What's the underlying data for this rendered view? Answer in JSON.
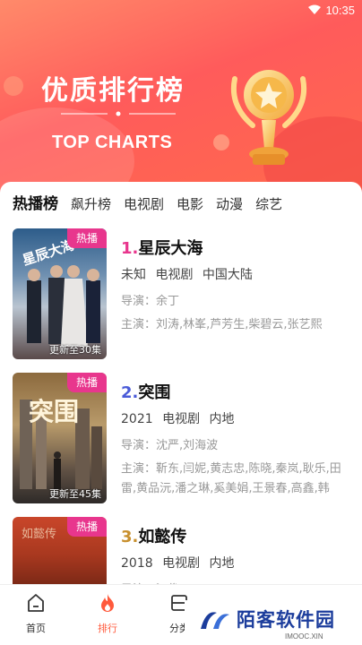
{
  "status_bar": {
    "time": "10:35"
  },
  "banner": {
    "title": "优质排行榜",
    "subtitle": "TOP CHARTS"
  },
  "tabs": [
    {
      "label": "热播榜",
      "active": true
    },
    {
      "label": "飙升榜"
    },
    {
      "label": "电视剧"
    },
    {
      "label": "电影"
    },
    {
      "label": "动漫"
    },
    {
      "label": "综艺"
    }
  ],
  "items": [
    {
      "rank": "1.",
      "rank_color": "#e8368d",
      "title": "星辰大海",
      "year": "未知",
      "type": "电视剧",
      "region": "中国大陆",
      "director": "导演：余丁",
      "cast": "主演：刘涛,林峯,芦芳生,柴碧云,张艺熙",
      "badge": "热播",
      "episode": "更新至30集",
      "poster_text": "星辰大海"
    },
    {
      "rank": "2.",
      "rank_color": "#4a5bd8",
      "title": "突围",
      "year": "2021",
      "type": "电视剧",
      "region": "内地",
      "director": "导演：沈严,刘海波",
      "cast": "主演：靳东,闫妮,黄志忠,陈晓,秦岚,耿乐,田雷,黄品沅,潘之琳,奚美娟,王景春,高鑫,韩童...",
      "badge": "热播",
      "episode": "更新至45集",
      "poster_text": "突围"
    },
    {
      "rank": "3.",
      "rank_color": "#c8902e",
      "title": "如懿传",
      "year": "2018",
      "type": "电视剧",
      "region": "内地",
      "director": "导演：汪俊",
      "cast": "",
      "badge": "热播",
      "episode": "",
      "poster_text": "如懿传"
    }
  ],
  "bottom_nav": [
    {
      "label": "首页",
      "icon": "home-icon"
    },
    {
      "label": "排行",
      "icon": "flame-icon",
      "active": true
    },
    {
      "label": "分类",
      "icon": "category-icon"
    }
  ],
  "watermark": {
    "text": "陌客软件园",
    "sub": "IMOOC.XIN"
  },
  "colors": {
    "accent": "#ff5a3c",
    "badge": "#e8368d"
  }
}
